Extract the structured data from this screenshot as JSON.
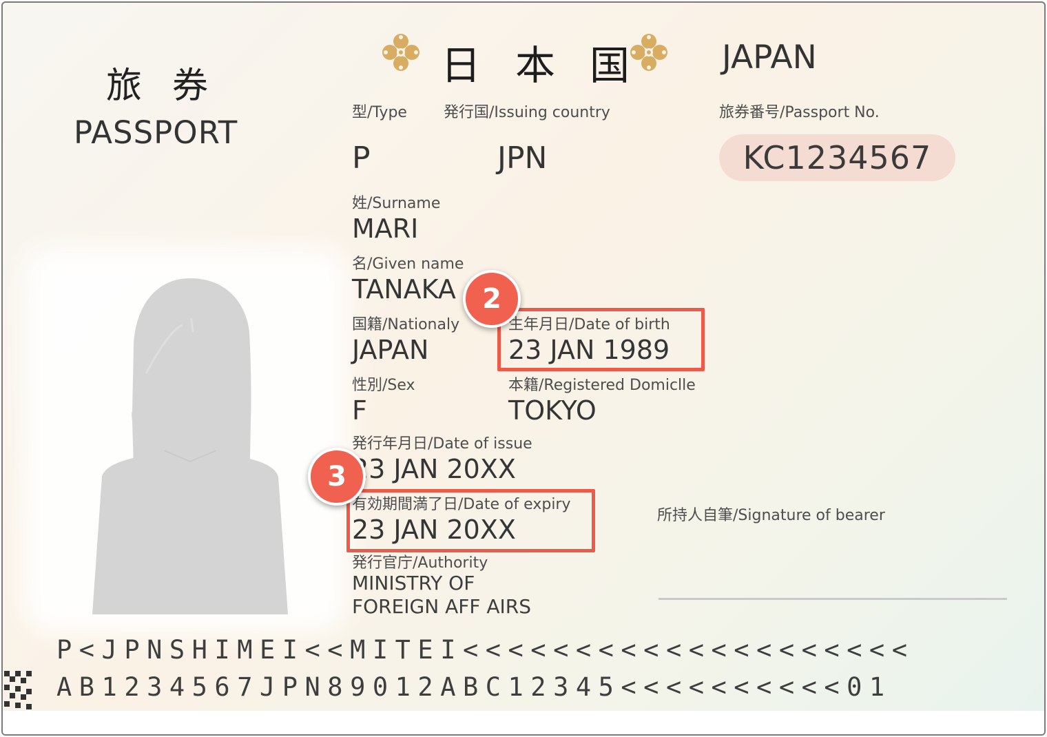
{
  "header": {
    "title_jp": "旅券",
    "title_en": "PASSPORT",
    "country_jp": "日本国",
    "country_en": "JAPAN"
  },
  "fields": {
    "type": {
      "label": "型/Type",
      "value": "P"
    },
    "issuing_country": {
      "label": "発行国/Issuing country",
      "value": "JPN"
    },
    "passport_no": {
      "label": "旅券番号/Passport  No.",
      "value": "KC1234567"
    },
    "surname": {
      "label": "姓/Surname",
      "value": "MARI"
    },
    "given_name": {
      "label": "名/Given name",
      "value": "TANAKA"
    },
    "nationality": {
      "label": "国籍/Nationaly",
      "value": "JAPAN"
    },
    "date_of_birth": {
      "label": "生年月日/Date of birth",
      "value": "23 JAN 1989"
    },
    "sex": {
      "label": "性別/Sex",
      "value": "F"
    },
    "registered_domicile": {
      "label": "本籍/Registered Domiclle",
      "value": "TOKYO"
    },
    "date_of_issue": {
      "label": "発行年月日/Date of issue",
      "value": "23 JAN 20XX"
    },
    "date_of_expiry": {
      "label": "有効期間満了日/Date of expiry",
      "value": "23 JAN 20XX"
    },
    "authority": {
      "label": "発行官庁/Authority",
      "value_line1": "MINISTRY OF",
      "value_line2": "FOREIGN AFF AIRS"
    },
    "signature": {
      "label": "所持人自筆/Signature of bearer"
    }
  },
  "annotations": [
    {
      "number": "2",
      "target": "date_of_birth"
    },
    {
      "number": "3",
      "target": "date_of_expiry"
    }
  ],
  "mrz": {
    "line1": "P<JPNSHIMEI<<MITEI<<<<<<<<<<<<<<<<<<<<",
    "line2": "AB1234567JPN89012ABC12345<<<<<<<<<<01"
  },
  "colors": {
    "highlight": "#ec5a4a",
    "badge": "#f0614f",
    "passport_no_pill": "#f4dcd3",
    "emblem_gold": "#d8ad62"
  },
  "icons": {
    "emblem": "paulownia-flower-emblem-icon",
    "photo": "person-silhouette-icon",
    "corner": "qr-code-icon"
  }
}
